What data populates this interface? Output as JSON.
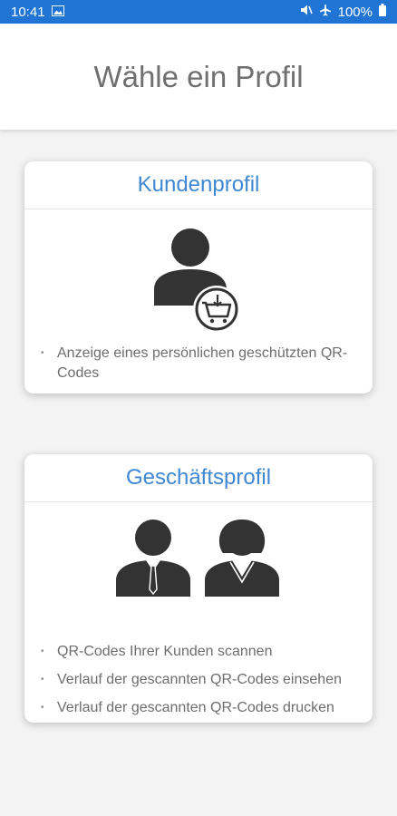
{
  "status_bar": {
    "time": "10:41",
    "battery": "100%"
  },
  "header": {
    "title": "Wähle ein Profil"
  },
  "customer_card": {
    "title": "Kundenprofil",
    "features": [
      "Anzeige eines persönlichen geschützten QR-Codes"
    ]
  },
  "business_card": {
    "title": "Geschäftsprofil",
    "features": [
      "QR-Codes Ihrer Kunden scannen",
      "Verlauf der gescannten QR-Codes einsehen",
      "Verlauf der gescannten QR-Codes drucken"
    ]
  },
  "colors": {
    "status_bar": "#1f74d4",
    "accent": "#3f87d3",
    "icon": "#333333",
    "background": "#f3f3f3"
  }
}
